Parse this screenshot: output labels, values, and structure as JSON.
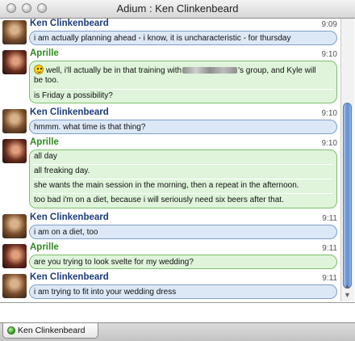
{
  "window": {
    "title": "Adium : Ken Clinkenbeard"
  },
  "messages": [
    {
      "sender": "Ken Clinkenbeard",
      "time": "9:09",
      "lines": [
        "i am actually planning ahead - i know, it is uncharacteristic - for thursday"
      ]
    },
    {
      "sender": "Aprille",
      "time": "9:10",
      "lines": [
        "well, i'll actually be in that training with",
        "'s group, and Kyle will",
        "be too.",
        "is Friday a possibility?"
      ]
    },
    {
      "sender": "Ken Clinkenbeard",
      "time": "9:10",
      "lines": [
        "hmmm. what time is that thing?"
      ]
    },
    {
      "sender": "Aprille",
      "time": "9:10",
      "lines": [
        "all day",
        "all freaking day.",
        "she wants the main session in the morning, then a repeat in the afternoon.",
        "too bad i'm on a diet, because i will seriously need six beers after that."
      ]
    },
    {
      "sender": "Ken Clinkenbeard",
      "time": "9:11",
      "lines": [
        "i am on a diet, too"
      ]
    },
    {
      "sender": "Aprille",
      "time": "9:11",
      "lines": [
        "are you trying to look svelte for my wedding?"
      ]
    },
    {
      "sender": "Ken Clinkenbeard",
      "time": "9:11",
      "lines": [
        "i am trying to fit into your wedding dress"
      ]
    }
  ],
  "tabs": [
    {
      "label": "Ken Clinkenbeard",
      "status": "online"
    }
  ],
  "colors": {
    "ken_name": "#1c3c7d",
    "aprille_name": "#2f8a1e",
    "ken_bubble": "#dde8f7",
    "aprille_bubble": "#dff4da"
  }
}
